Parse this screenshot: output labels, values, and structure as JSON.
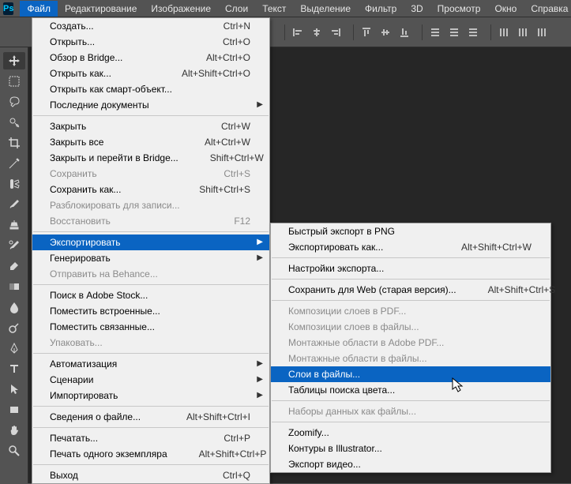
{
  "app_badge": "Ps",
  "menubar": {
    "items": [
      "Файл",
      "Редактирование",
      "Изображение",
      "Слои",
      "Текст",
      "Выделение",
      "Фильтр",
      "3D",
      "Просмотр",
      "Окно",
      "Справка"
    ],
    "open_index": 0
  },
  "file_menu": [
    {
      "label": "Создать...",
      "shortcut": "Ctrl+N"
    },
    {
      "label": "Открыть...",
      "shortcut": "Ctrl+O"
    },
    {
      "label": "Обзор в Bridge...",
      "shortcut": "Alt+Ctrl+O"
    },
    {
      "label": "Открыть как...",
      "shortcut": "Alt+Shift+Ctrl+O"
    },
    {
      "label": "Открыть как смарт-объект..."
    },
    {
      "label": "Последние документы",
      "arrow": true
    },
    {
      "sep": true
    },
    {
      "label": "Закрыть",
      "shortcut": "Ctrl+W"
    },
    {
      "label": "Закрыть все",
      "shortcut": "Alt+Ctrl+W"
    },
    {
      "label": "Закрыть и перейти в Bridge...",
      "shortcut": "Shift+Ctrl+W"
    },
    {
      "label": "Сохранить",
      "shortcut": "Ctrl+S",
      "disabled": true
    },
    {
      "label": "Сохранить как...",
      "shortcut": "Shift+Ctrl+S"
    },
    {
      "label": "Разблокировать для записи...",
      "disabled": true
    },
    {
      "label": "Восстановить",
      "shortcut": "F12",
      "disabled": true
    },
    {
      "sep": true
    },
    {
      "label": "Экспортировать",
      "arrow": true,
      "highlight": true
    },
    {
      "label": "Генерировать",
      "arrow": true
    },
    {
      "label": "Отправить на Behance...",
      "disabled": true
    },
    {
      "sep": true
    },
    {
      "label": "Поиск в Adobe Stock..."
    },
    {
      "label": "Поместить встроенные..."
    },
    {
      "label": "Поместить связанные..."
    },
    {
      "label": "Упаковать...",
      "disabled": true
    },
    {
      "sep": true
    },
    {
      "label": "Автоматизация",
      "arrow": true
    },
    {
      "label": "Сценарии",
      "arrow": true
    },
    {
      "label": "Импортировать",
      "arrow": true
    },
    {
      "sep": true
    },
    {
      "label": "Сведения о файле...",
      "shortcut": "Alt+Shift+Ctrl+I"
    },
    {
      "sep": true
    },
    {
      "label": "Печатать...",
      "shortcut": "Ctrl+P"
    },
    {
      "label": "Печать одного экземпляра",
      "shortcut": "Alt+Shift+Ctrl+P"
    },
    {
      "sep": true
    },
    {
      "label": "Выход",
      "shortcut": "Ctrl+Q"
    }
  ],
  "export_menu": [
    {
      "label": "Быстрый экспорт в PNG"
    },
    {
      "label": "Экспортировать как...",
      "shortcut": "Alt+Shift+Ctrl+W"
    },
    {
      "sep": true
    },
    {
      "label": "Настройки экспорта..."
    },
    {
      "sep": true
    },
    {
      "label": "Сохранить для Web (старая версия)...",
      "shortcut": "Alt+Shift+Ctrl+S"
    },
    {
      "sep": true
    },
    {
      "label": "Композиции слоев в PDF...",
      "disabled": true
    },
    {
      "label": "Композиции слоев в файлы...",
      "disabled": true
    },
    {
      "label": "Монтажные области в Adobe PDF...",
      "disabled": true
    },
    {
      "label": "Монтажные области в файлы...",
      "disabled": true
    },
    {
      "label": "Слои в файлы...",
      "highlight": true
    },
    {
      "label": "Таблицы поиска цвета..."
    },
    {
      "sep": true
    },
    {
      "label": "Наборы данных как файлы...",
      "disabled": true
    },
    {
      "sep": true
    },
    {
      "label": "Zoomify..."
    },
    {
      "label": "Контуры в Illustrator..."
    },
    {
      "label": "Экспорт видео..."
    }
  ],
  "tools": [
    "move-tool",
    "marquee-tool",
    "lasso-tool",
    "quick-select-tool",
    "crop-tool",
    "eyedropper-tool",
    "spot-heal-tool",
    "brush-tool",
    "clone-stamp-tool",
    "history-brush-tool",
    "eraser-tool",
    "gradient-tool",
    "blur-tool",
    "dodge-tool",
    "pen-tool",
    "type-tool",
    "path-select-tool",
    "rectangle-tool",
    "hand-tool",
    "zoom-tool"
  ]
}
